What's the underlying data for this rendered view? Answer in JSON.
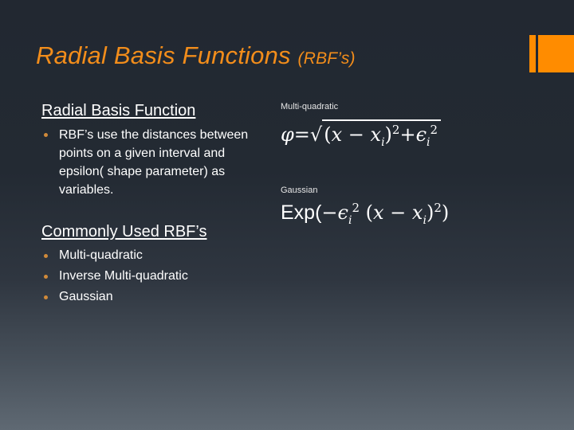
{
  "slide": {
    "title": "Radial Basis Functions",
    "title_suffix": "(RBF’s)",
    "accent_color": "#ff8c00",
    "title_color": "#f28d1b"
  },
  "section1": {
    "heading": "Radial Basis Function",
    "bullets": [
      "RBF’s use the distances between points on a given interval and epsilon( shape parameter) as variables."
    ]
  },
  "section2": {
    "heading": "Commonly Used RBF’s",
    "bullets": [
      "Multi-quadratic",
      "Inverse Multi-quadratic",
      "Gaussian"
    ]
  },
  "formulas": [
    {
      "label": "Multi-quadratic",
      "lhs": "φ=",
      "sqrt_symbol": "√",
      "body": "(x − x_i)^2 + ϵ_i^2",
      "parts": {
        "open": "(",
        "x": "x",
        "minus": " − ",
        "xi": "x",
        "i": "i",
        "close": ")",
        "sq": "2",
        "plus": "+",
        "eps": "ϵ",
        "sq2": "2"
      }
    },
    {
      "label": "Gaussian",
      "body": "Exp(−ϵ_i^2 (x − x_i)^2)",
      "parts": {
        "exp": "Exp(",
        "neg": "−",
        "eps": "ϵ",
        "i": "i",
        "sq": "2",
        "open": " (",
        "x": "x",
        "minus": " − ",
        "xi": "x",
        "close": ")",
        "sq2": "2",
        "end": ")"
      }
    }
  ]
}
